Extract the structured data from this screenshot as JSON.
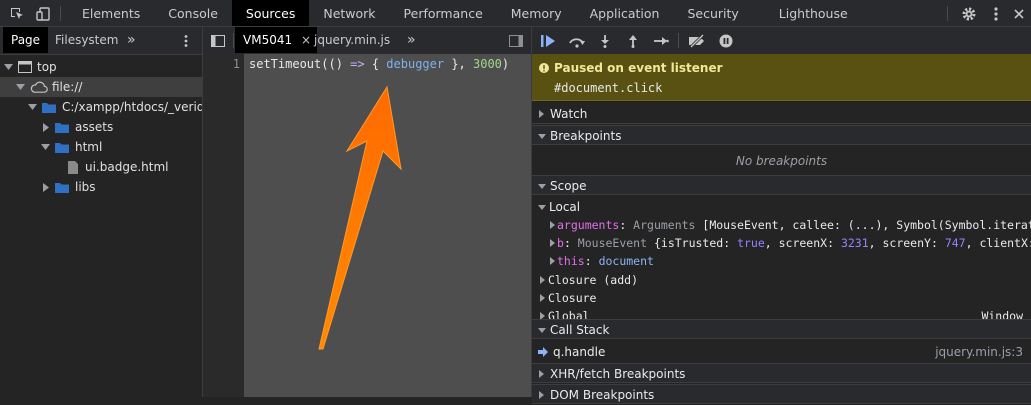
{
  "topbar": {
    "tabs": [
      "Elements",
      "Console",
      "Sources",
      "Network",
      "Performance",
      "Memory",
      "Application",
      "Security",
      "Lighthouse"
    ],
    "active_tab": "Sources",
    "icons": [
      "inspect-element-icon",
      "device-toolbar-icon",
      "settings-gear-icon",
      "kebab-menu-icon"
    ]
  },
  "navigator": {
    "tabs": [
      "Page",
      "Filesystem"
    ],
    "more_label": "»",
    "tree": [
      {
        "label": "top"
      },
      {
        "label": "file://"
      },
      {
        "label": "C:/xampp/htdocs/_veridate"
      },
      {
        "label": "assets"
      },
      {
        "label": "html"
      },
      {
        "label": "ui.badge.html"
      },
      {
        "label": "libs"
      }
    ]
  },
  "editor": {
    "tabs": [
      {
        "label": "VM5041",
        "close": "×"
      },
      {
        "label": "jquery.min.js"
      }
    ],
    "more_label": "»",
    "line_number": "1",
    "code": {
      "part1": "setTimeout(() ",
      "arrow": "=>",
      "part2": " { ",
      "debugger": "debugger",
      "part3": " }, ",
      "number": "3000",
      "part4": ")"
    }
  },
  "debugger": {
    "paused": {
      "title": "Paused on event listener",
      "detail": "#document.click"
    },
    "sections": {
      "watch": "Watch",
      "breakpoints": "Breakpoints",
      "no_breakpoints": "No breakpoints",
      "scope": "Scope",
      "call_stack": "Call Stack",
      "xhr": "XHR/fetch Breakpoints",
      "dom": "DOM Breakpoints"
    },
    "scope": {
      "local_label": "Local",
      "arguments": {
        "name": "arguments",
        "type": "Arguments",
        "rest": " [MouseEvent, callee: (...), Symbol(Symbol.iterato…"
      },
      "b": {
        "name": "b",
        "type": "MouseEvent",
        "p1": " {isTrusted: ",
        "bool": "true",
        "p2": ", screenX: ",
        "sx": "3231",
        "p3": ", screenY: ",
        "sy": "747",
        "p4": ", clientX: …"
      },
      "this": {
        "name": "this",
        "value": "document"
      },
      "closure_add": "Closure (add)",
      "closure": "Closure",
      "global": "Global",
      "global_value": "Window"
    },
    "call_stack": {
      "frame": "q.handle",
      "location": "jquery.min.js:3"
    }
  },
  "colors": {
    "accent": "#8ab4f8",
    "paused_bg": "#595112",
    "arrow": "#ff7a00"
  }
}
